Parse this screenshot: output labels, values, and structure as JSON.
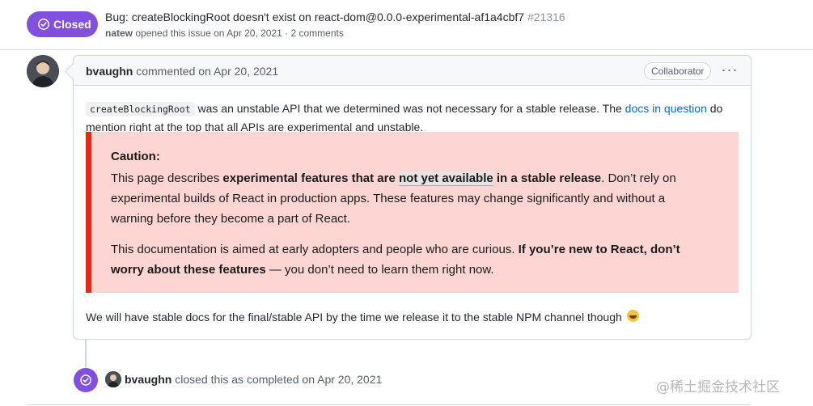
{
  "issue": {
    "status": "Closed",
    "title": "Bug: createBlockingRoot doesn't exist on react-dom@0.0.0-experimental-af1a4cbf7",
    "number": "#21316",
    "opener": "natew",
    "opened_text": "opened this issue on Apr 20, 2021 · 2 comments"
  },
  "comment": {
    "author": "bvaughn",
    "action": "commented on Apr 20, 2021",
    "role_badge": "Collaborator",
    "menu_label": "···",
    "code": "createBlockingRoot",
    "text_1": " was an unstable API that we determined was not necessary for a stable release. The ",
    "link": "docs in question",
    "text_2": " do mention right at the top that all APIs are experimental and unstable.",
    "caution": {
      "heading": "Caution:",
      "p1_a": "This page describes ",
      "p1_b": "experimental features that are ",
      "p1_highlight": "not yet available",
      "p1_c": " in a stable release",
      "p1_d": ". Don’t rely on experimental builds of React in production apps. These features may change significantly and without a warning before they become a part of React.",
      "p2_a": "This documentation is aimed at early adopters and people who are curious. ",
      "p2_b": "If you’re new to React, don’t worry about these features",
      "p2_c": " — you don’t need to learn them right now."
    },
    "footer": "We will have stable docs for the final/stable API by the time we release it to the stable NPM channel though",
    "footer_emoji": "smile-emoji"
  },
  "event": {
    "actor": "bvaughn",
    "text": "closed this as completed on Apr 20, 2021"
  },
  "watermark": "@稀土掘金技术社区",
  "colors": {
    "closed_purple": "#8250df",
    "link_blue": "#0969da",
    "caution_bg": "#fdd6d4",
    "caution_border": "#e0281d"
  }
}
